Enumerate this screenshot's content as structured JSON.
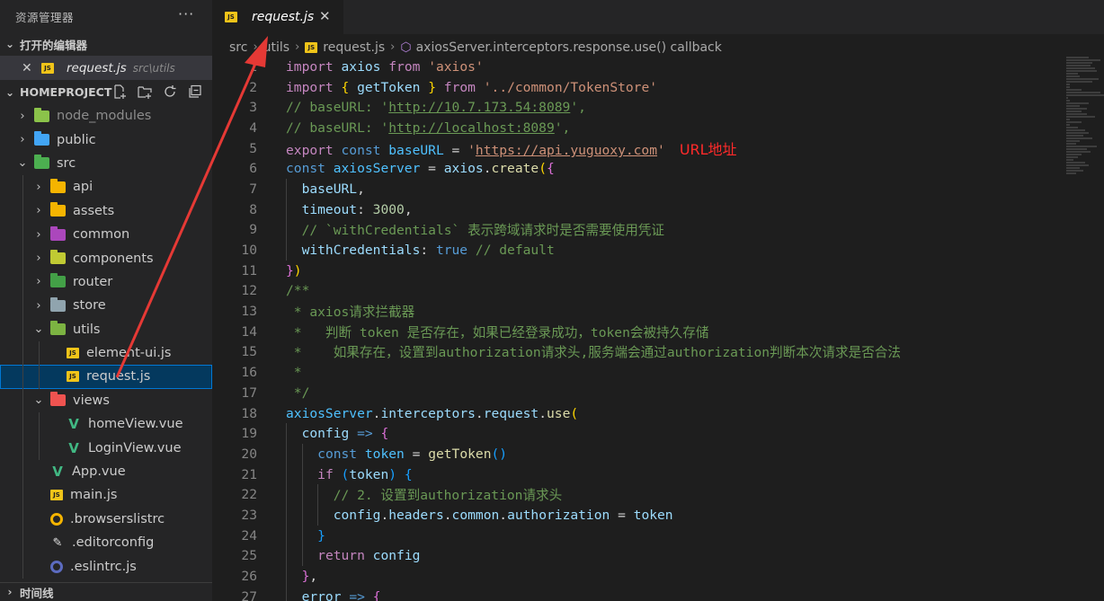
{
  "sidebar": {
    "title": "资源管理器",
    "more": "···",
    "open_editors": {
      "label": "打开的编辑器",
      "items": [
        {
          "close": "✕",
          "icon": "JS",
          "name": "request.js",
          "path": "src\\utils"
        }
      ]
    },
    "project": {
      "label": "HOMEPROJECT",
      "actions": [
        "new-file-icon",
        "new-folder-icon",
        "refresh-icon",
        "collapse-all-icon"
      ]
    },
    "tree": [
      {
        "label": "node_modules",
        "type": "folder",
        "expanded": false,
        "color": "#8bc34a",
        "dim": true
      },
      {
        "label": "public",
        "type": "folder",
        "expanded": false,
        "color": "#42a5f5"
      },
      {
        "label": "src",
        "type": "folder",
        "expanded": true,
        "color": "#4caf50"
      },
      {
        "label": "api",
        "type": "folder",
        "expanded": false,
        "color": "#f5b400"
      },
      {
        "label": "assets",
        "type": "folder",
        "expanded": false,
        "color": "#f5b400"
      },
      {
        "label": "common",
        "type": "folder",
        "expanded": false,
        "color": "#ab47bc"
      },
      {
        "label": "components",
        "type": "folder",
        "expanded": false,
        "color": "#c0ca33"
      },
      {
        "label": "router",
        "type": "folder",
        "expanded": false,
        "color": "#43a047"
      },
      {
        "label": "store",
        "type": "folder",
        "expanded": false,
        "color": "#90a4ae"
      },
      {
        "label": "utils",
        "type": "folder",
        "expanded": true,
        "color": "#7cb342"
      },
      {
        "label": "element-ui.js",
        "type": "js"
      },
      {
        "label": "request.js",
        "type": "js",
        "selected": true
      },
      {
        "label": "views",
        "type": "folder",
        "expanded": true,
        "color": "#ef5350"
      },
      {
        "label": "homeView.vue",
        "type": "vue"
      },
      {
        "label": "LoginView.vue",
        "type": "vue"
      },
      {
        "label": "App.vue",
        "type": "vue"
      },
      {
        "label": "main.js",
        "type": "js"
      },
      {
        "label": ".browserslistrc",
        "type": "browserslist"
      },
      {
        "label": ".editorconfig",
        "type": "editorconfig"
      },
      {
        "label": ".eslintrc.js",
        "type": "eslint"
      }
    ],
    "timeline_label": "时间线"
  },
  "editor": {
    "tab": {
      "icon": "JS",
      "name": "request.js",
      "close": "✕"
    },
    "breadcrumb": {
      "parts": [
        "src",
        "utils",
        "request.js",
        "axiosServer.interceptors.response.use() callback"
      ]
    },
    "annotation": "URL地址",
    "lines": [
      {
        "n": "1",
        "tokens": [
          [
            "kw",
            "import"
          ],
          [
            "pun",
            " "
          ],
          [
            "var",
            "axios"
          ],
          [
            "pun",
            " "
          ],
          [
            "kw",
            "from"
          ],
          [
            "pun",
            " "
          ],
          [
            "str",
            "'axios'"
          ]
        ]
      },
      {
        "n": "2",
        "tokens": [
          [
            "kw",
            "import"
          ],
          [
            "pun",
            " "
          ],
          [
            "br1",
            "{"
          ],
          [
            "pun",
            " "
          ],
          [
            "var",
            "getToken"
          ],
          [
            "pun",
            " "
          ],
          [
            "br1",
            "}"
          ],
          [
            "pun",
            " "
          ],
          [
            "kw",
            "from"
          ],
          [
            "pun",
            " "
          ],
          [
            "str",
            "'../common/TokenStore'"
          ]
        ]
      },
      {
        "n": "3",
        "tokens": [
          [
            "cmt",
            "// baseURL: '"
          ],
          [
            "cmtu",
            "http://10.7.173.54:8089"
          ],
          [
            "cmt",
            "',"
          ]
        ]
      },
      {
        "n": "4",
        "tokens": [
          [
            "cmt",
            "// baseURL: '"
          ],
          [
            "cmtu",
            "http://localhost:8089"
          ],
          [
            "cmt",
            "',"
          ]
        ]
      },
      {
        "n": "5",
        "tokens": [
          [
            "kw",
            "export"
          ],
          [
            "pun",
            " "
          ],
          [
            "kwb",
            "const"
          ],
          [
            "pun",
            " "
          ],
          [
            "cst",
            "baseURL"
          ],
          [
            "pun",
            " = "
          ],
          [
            "str",
            "'"
          ],
          [
            "stru",
            "https://api.yuguoxy.com"
          ],
          [
            "str",
            "'"
          ]
        ],
        "annot": true
      },
      {
        "n": "6",
        "tokens": [
          [
            "kwb",
            "const"
          ],
          [
            "pun",
            " "
          ],
          [
            "cst",
            "axiosServer"
          ],
          [
            "pun",
            " = "
          ],
          [
            "var",
            "axios"
          ],
          [
            "pun",
            "."
          ],
          [
            "fn",
            "create"
          ],
          [
            "br1",
            "("
          ],
          [
            "br2",
            "{"
          ]
        ]
      },
      {
        "n": "7",
        "tokens": [
          [
            "pun",
            "  "
          ],
          [
            "var",
            "baseURL"
          ],
          [
            "pun",
            ","
          ]
        ]
      },
      {
        "n": "8",
        "tokens": [
          [
            "pun",
            "  "
          ],
          [
            "var",
            "timeout"
          ],
          [
            "pun",
            ": "
          ],
          [
            "num",
            "3000"
          ],
          [
            "pun",
            ","
          ]
        ]
      },
      {
        "n": "9",
        "tokens": [
          [
            "pun",
            "  "
          ],
          [
            "cmt",
            "// `withCredentials` 表示跨域请求时是否需要使用凭证"
          ]
        ]
      },
      {
        "n": "10",
        "tokens": [
          [
            "pun",
            "  "
          ],
          [
            "var",
            "withCredentials"
          ],
          [
            "pun",
            ": "
          ],
          [
            "kwb",
            "true"
          ],
          [
            "pun",
            " "
          ],
          [
            "cmt",
            "// default"
          ]
        ]
      },
      {
        "n": "11",
        "tokens": [
          [
            "br2",
            "}"
          ],
          [
            "br1",
            ")"
          ]
        ]
      },
      {
        "n": "12",
        "tokens": [
          [
            "cmt",
            "/**"
          ]
        ]
      },
      {
        "n": "13",
        "tokens": [
          [
            "cmt",
            " * axios请求拦截器"
          ]
        ]
      },
      {
        "n": "14",
        "tokens": [
          [
            "cmt",
            " *   判断 token 是否存在，如果已经登录成功，token会被持久存储"
          ]
        ]
      },
      {
        "n": "15",
        "tokens": [
          [
            "cmt",
            " *    如果存在，设置到authorization请求头,服务端会通过authorization判断本次请求是否合法"
          ]
        ]
      },
      {
        "n": "16",
        "tokens": [
          [
            "cmt",
            " *"
          ]
        ]
      },
      {
        "n": "17",
        "tokens": [
          [
            "cmt",
            " */"
          ]
        ]
      },
      {
        "n": "18",
        "tokens": [
          [
            "cst",
            "axiosServer"
          ],
          [
            "pun",
            "."
          ],
          [
            "var",
            "interceptors"
          ],
          [
            "pun",
            "."
          ],
          [
            "var",
            "request"
          ],
          [
            "pun",
            "."
          ],
          [
            "fn",
            "use"
          ],
          [
            "br1",
            "("
          ]
        ]
      },
      {
        "n": "19",
        "tokens": [
          [
            "pun",
            "  "
          ],
          [
            "var",
            "config"
          ],
          [
            "pun",
            " "
          ],
          [
            "kwb",
            "=>"
          ],
          [
            "pun",
            " "
          ],
          [
            "br2",
            "{"
          ]
        ]
      },
      {
        "n": "20",
        "tokens": [
          [
            "pun",
            "    "
          ],
          [
            "kwb",
            "const"
          ],
          [
            "pun",
            " "
          ],
          [
            "cst",
            "token"
          ],
          [
            "pun",
            " = "
          ],
          [
            "fn",
            "getToken"
          ],
          [
            "br3",
            "()"
          ]
        ]
      },
      {
        "n": "21",
        "tokens": [
          [
            "pun",
            "    "
          ],
          [
            "kw",
            "if"
          ],
          [
            "pun",
            " "
          ],
          [
            "br3",
            "("
          ],
          [
            "var",
            "token"
          ],
          [
            "br3",
            ")"
          ],
          [
            "pun",
            " "
          ],
          [
            "br3",
            "{"
          ]
        ]
      },
      {
        "n": "22",
        "tokens": [
          [
            "pun",
            "      "
          ],
          [
            "cmt",
            "// 2. 设置到authorization请求头"
          ]
        ]
      },
      {
        "n": "23",
        "tokens": [
          [
            "pun",
            "      "
          ],
          [
            "var",
            "config"
          ],
          [
            "pun",
            "."
          ],
          [
            "var",
            "headers"
          ],
          [
            "pun",
            "."
          ],
          [
            "var",
            "common"
          ],
          [
            "pun",
            "."
          ],
          [
            "var",
            "authorization"
          ],
          [
            "pun",
            " = "
          ],
          [
            "var",
            "token"
          ]
        ]
      },
      {
        "n": "24",
        "tokens": [
          [
            "pun",
            "    "
          ],
          [
            "br3",
            "}"
          ]
        ]
      },
      {
        "n": "25",
        "tokens": [
          [
            "pun",
            "    "
          ],
          [
            "kw",
            "return"
          ],
          [
            "pun",
            " "
          ],
          [
            "var",
            "config"
          ]
        ]
      },
      {
        "n": "26",
        "tokens": [
          [
            "pun",
            "  "
          ],
          [
            "br2",
            "}"
          ],
          [
            "pun",
            ","
          ]
        ]
      },
      {
        "n": "27",
        "tokens": [
          [
            "pun",
            "  "
          ],
          [
            "var",
            "error"
          ],
          [
            "pun",
            " "
          ],
          [
            "kwb",
            "=>"
          ],
          [
            "pun",
            " "
          ],
          [
            "br2",
            "{"
          ]
        ]
      }
    ]
  },
  "colors": {
    "accent": "#0078d4",
    "arrow": "#e53935",
    "annotation": "#ff2a2a"
  }
}
